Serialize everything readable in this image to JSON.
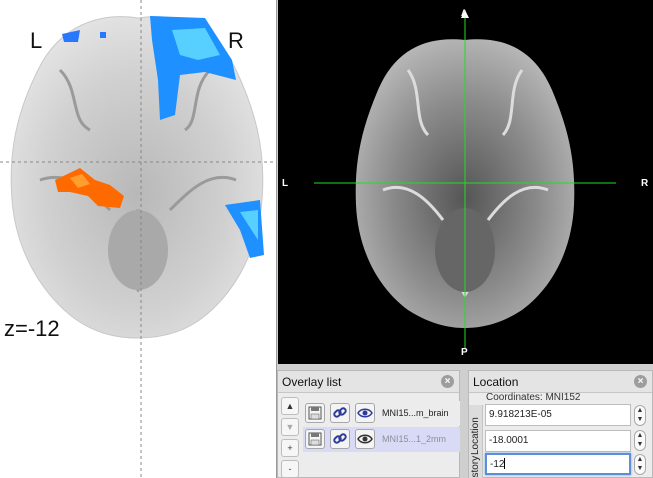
{
  "figure": {
    "left_label": "L",
    "right_label": "R",
    "slice_label": "z=-12"
  },
  "viewer": {
    "orientation": {
      "left": "L",
      "right": "R",
      "anterior": "A",
      "posterior": "P"
    },
    "crosshair_color": "#22dd22"
  },
  "overlay_panel": {
    "title": "Overlay list",
    "side_buttons": [
      "▲",
      "▼",
      "+",
      "-"
    ],
    "layers": [
      {
        "name": "MNI15...m_brain",
        "selected": false
      },
      {
        "name": "MNI15...1_2mm",
        "selected": true
      }
    ]
  },
  "location_panel": {
    "title": "Location",
    "coordinates_label": "Coordinates: MNI152",
    "tab_location": "Location",
    "tab_history": "History",
    "x_value": "9.918213E-05",
    "y_value": "-18.0001",
    "z_value": "-12"
  },
  "icons": {
    "close": "close-icon",
    "save": "save-icon",
    "link": "link-icon",
    "eye": "eye-icon"
  },
  "colors": {
    "activation_positive": "#ff6a00",
    "activation_negative": "#1e90ff",
    "selection": "#d9dbf6"
  }
}
